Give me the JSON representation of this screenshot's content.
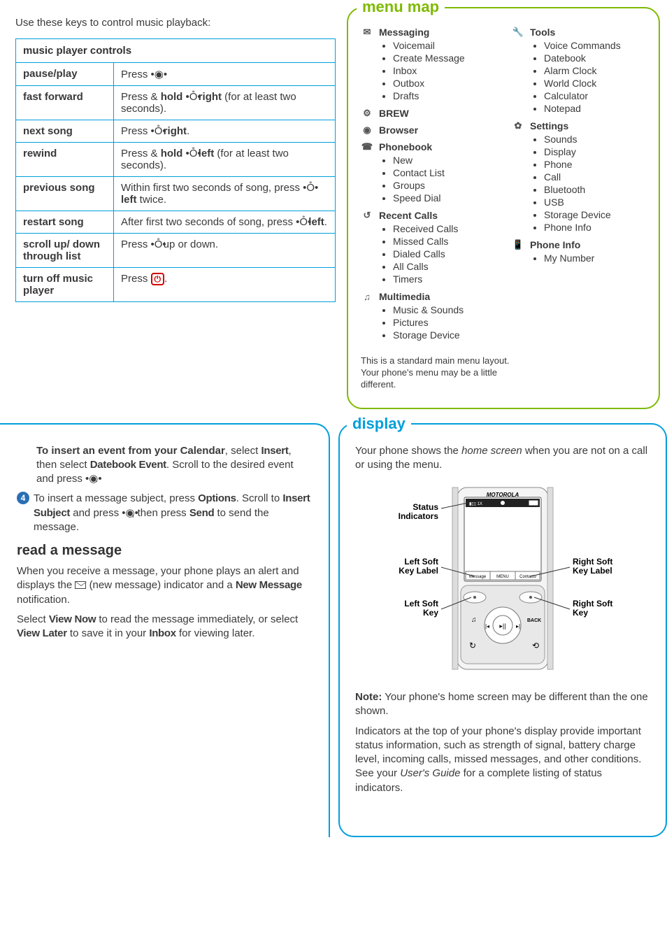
{
  "music": {
    "intro": "Use these keys to control music playback:",
    "table_header": "music player controls",
    "rows": [
      {
        "label": "pause/play",
        "pre": "Press ",
        "key": "center",
        "bold": "",
        "post": "."
      },
      {
        "label": "fast forward",
        "pre": "Press & ",
        "bold": "hold ",
        "key": "nav",
        "bold2": " right",
        "post": " (for at least two seconds)."
      },
      {
        "label": "next song",
        "pre": "Press ",
        "key": "nav",
        "bold2": " right",
        "post": "."
      },
      {
        "label": "rewind",
        "pre": "Press & ",
        "bold": "hold ",
        "key": "nav",
        "bold2": " left",
        "post": " (for at least two seconds)."
      },
      {
        "label": "previous song",
        "pre": "Within first two seconds of song, press ",
        "key": "nav",
        "bold2": " left",
        "post": " twice."
      },
      {
        "label": "restart song",
        "pre": "After first two seconds of song, press ",
        "key": "nav",
        "bold2": " left",
        "post": "."
      },
      {
        "label": "scroll up/ down through list",
        "pre": "Press ",
        "key": "nav",
        "post": " up or down."
      },
      {
        "label": "turn off music player",
        "pre": "Press ",
        "key": "end",
        "post": "."
      }
    ]
  },
  "menu": {
    "title": "menu map",
    "left": [
      {
        "icon": "✉",
        "name": "Messaging",
        "items": [
          "Voicemail",
          "Create Message",
          "Inbox",
          "Outbox",
          "Drafts"
        ]
      },
      {
        "icon": "⚙",
        "name": "BREW",
        "items": []
      },
      {
        "icon": "◉",
        "name": "Browser",
        "items": []
      },
      {
        "icon": "☎",
        "name": "Phonebook",
        "items": [
          "New",
          "Contact List",
          "Groups",
          "Speed Dial"
        ]
      },
      {
        "icon": "↺",
        "name": "Recent Calls",
        "items": [
          "Received Calls",
          "Missed Calls",
          "Dialed Calls",
          "All Calls",
          "Timers"
        ]
      },
      {
        "icon": "♫",
        "name": "Multimedia",
        "items": [
          "Music & Sounds",
          "Pictures",
          "Storage Device"
        ]
      }
    ],
    "right": [
      {
        "icon": "🔧",
        "name": "Tools",
        "items": [
          "Voice Commands",
          "Datebook",
          "Alarm Clock",
          "World Clock",
          "Calculator",
          "Notepad"
        ]
      },
      {
        "icon": "✿",
        "name": "Settings",
        "items": [
          "Sounds",
          "Display",
          "Phone",
          "Call",
          "Bluetooth",
          "USB",
          "Storage Device",
          "Phone Info"
        ]
      },
      {
        "icon": "📱",
        "name": "Phone Info",
        "items": [
          "My Number"
        ]
      }
    ],
    "note": "This is a standard main menu layout. Your phone's menu may be a little different."
  },
  "lowerLeft": {
    "cal_prefix_bold": "To insert an event from your Calendar",
    "cal_rest": ", select ",
    "insert": "Insert",
    "cal_rest2": ", then select ",
    "dbevent": "Datebook Event",
    "cal_rest3": ". Scroll to the desired event and press ",
    "cal_rest4": ".",
    "step4_pre": "To insert a message subject, press ",
    "options": "Options",
    "step4_mid": ". Scroll to ",
    "insub": "Insert Subject",
    "step4_mid2": " and press ",
    "step4_mid3": ", then press ",
    "send": "Send",
    "step4_end": " to send the message.",
    "read_head": "read a message",
    "read_p1a": "When you receive a message, your phone plays an alert and displays the ",
    "read_p1b": " (new message) indicator and a ",
    "newmsg": "New Message",
    "read_p1c": " notification.",
    "read_p2a": "Select ",
    "viewnow": "View Now",
    "read_p2b": " to read the message immediately, or select ",
    "viewlater": "View Later",
    "read_p2c": " to save it in your ",
    "inbox": "Inbox",
    "read_p2d": " for viewing later."
  },
  "display": {
    "title": "display",
    "p1a": "Your phone shows the ",
    "p1i": "home screen",
    "p1b": " when you are not on a call or using the menu.",
    "labels": {
      "status": "Status Indicators",
      "lsoftlabel": "Left Soft Key Label",
      "rsoftlabel": "Right Soft Key Label",
      "lsoft": "Left Soft Key",
      "rsoft": "Right Soft Key"
    },
    "screen": {
      "brand": "MOTOROLA",
      "left": "Message",
      "center": "MENU",
      "right": "Contacts",
      "back": "BACK"
    },
    "note_bold": "Note:",
    "note": " Your phone's home screen may be different than the one shown.",
    "p2a": "Indicators at the top of your phone's display provide important status information, such as strength of signal, battery charge level, incoming calls, missed messages, and other conditions. See your ",
    "p2i": "User's Guide",
    "p2b": " for a complete listing of status indicators."
  }
}
